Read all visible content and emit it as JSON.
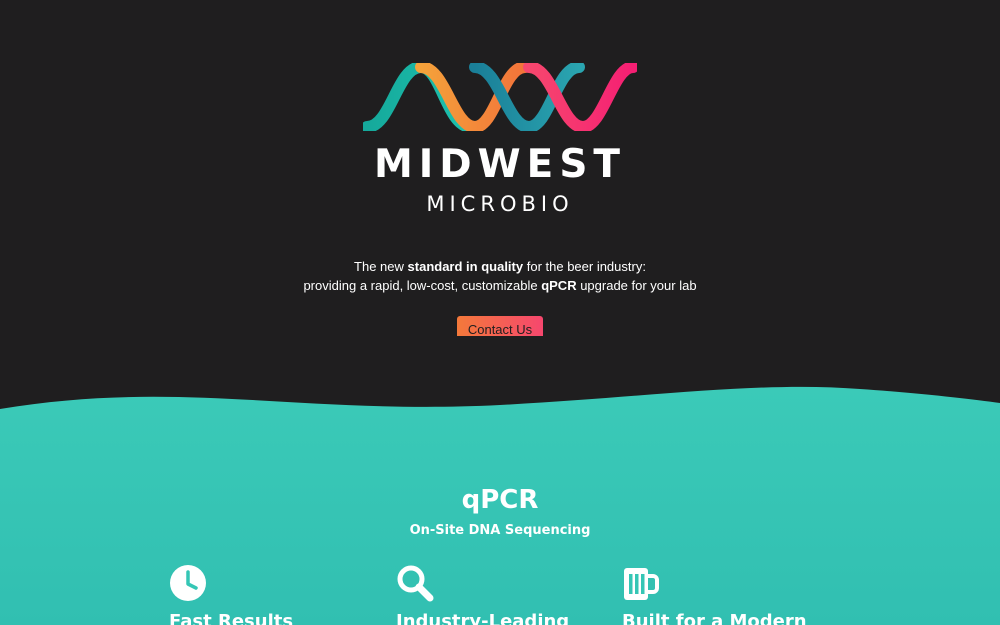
{
  "brand": {
    "name": "MIDWEST",
    "sub": "MICROBIO",
    "colors": [
      "#18b3a3",
      "#f28b3a",
      "#1f8ea0",
      "#f5406e"
    ]
  },
  "hero": {
    "line1_pre": "The new ",
    "line1_bold": "standard in quality",
    "line1_post": " for the beer industry:",
    "line2_pre": "providing a rapid, low-cost, customizable ",
    "line2_bold": "qPCR",
    "line2_post": " upgrade for your lab",
    "cta_label": "Contact Us",
    "background": "#1f1e1f"
  },
  "section": {
    "title": "qPCR",
    "subtitle": "On-Site DNA Sequencing",
    "background": "#35c6b5"
  },
  "features": [
    {
      "icon": "clock-icon",
      "title": "Fast Results"
    },
    {
      "icon": "magnifier-icon",
      "title": "Industry-Leading"
    },
    {
      "icon": "beer-mug-icon",
      "title": "Built for a Modern"
    }
  ]
}
